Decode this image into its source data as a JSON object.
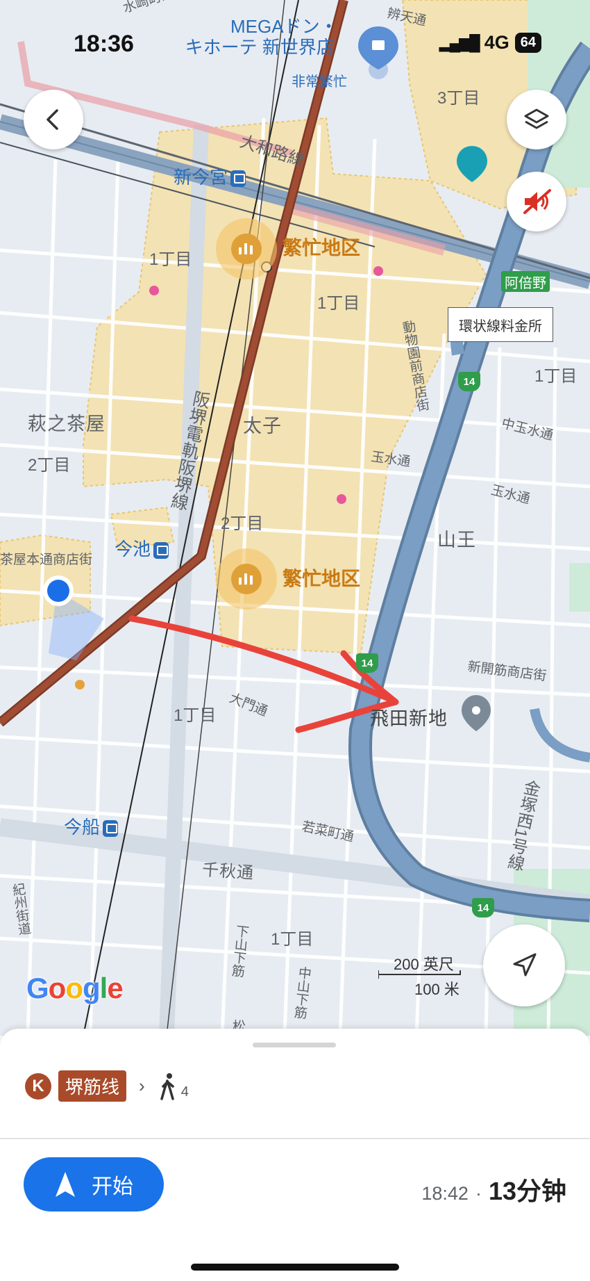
{
  "status_bar": {
    "time": "18:36",
    "network": "4G",
    "battery": "64"
  },
  "map": {
    "poi_name_line1": "MEGAドン・",
    "poi_name_line2": "キホーテ 新世界店",
    "poi_busy": "非常繁忙",
    "stations": {
      "shin_imamiya": "新今宮",
      "imaike": "今池",
      "imafune": "今船"
    },
    "line_name_yamatoji": "大和路線",
    "line_name_hankai": "阪堺電軌阪堺線",
    "busy_district_1": "繁忙地区",
    "busy_district_2": "繁忙地区",
    "areas": {
      "hagi": "萩之茶屋",
      "taishi": "太子",
      "sanno": "山王",
      "tobita": "飛田新地",
      "chome1_a": "1丁目",
      "chome1_b": "1丁目",
      "chome1_c": "1丁目",
      "chome1_d": "1丁目",
      "chome1_e": "1丁目",
      "chome2_a": "2丁目",
      "chome2_b": "2丁目",
      "chome3": "3丁目",
      "abeno": "阿倍野"
    },
    "streets": {
      "mizusaki": "水崎町通",
      "bentendori": "辨天通",
      "hagi_shotengai": "茶屋本通商店街",
      "dobutsuen": "動物園前商店街",
      "tamamizu": "玉水通",
      "naka_tamamizu": "中玉水通",
      "tamamizu2": "玉水通",
      "daimon": "大門通",
      "shinkaihatsu": "新開筋商店街",
      "wakana": "若菜町通",
      "senshu": "千秋通",
      "kishu": "紀州街道",
      "shimoyamashita": "下山下筋",
      "nakayamashita": "中山下筋",
      "kanazukanishi": "金塚西1号線",
      "matsu": "松"
    },
    "toll_label": "環状線料金所",
    "route_shield": "14",
    "scale": {
      "feet": "200 英尺",
      "meters": "100 米"
    },
    "logo": "Google",
    "colors": {
      "hankai_line": "#9b4a33",
      "highway": "#7a9ec4",
      "dense_area": "#f3e2b3",
      "user_dot": "#1a6fe8",
      "annotation": "#e8433a"
    }
  },
  "controls": {
    "back": "back-icon",
    "layers": "layers-icon",
    "mute": "mute-icon",
    "recenter": "navigation-arrow-icon"
  },
  "sheet": {
    "k_badge": "K",
    "line_name": "堺筋线",
    "walk_minutes": "4",
    "start_label": "开始",
    "arrival_time": "18:42",
    "separator": "·",
    "duration": "13分钟"
  }
}
